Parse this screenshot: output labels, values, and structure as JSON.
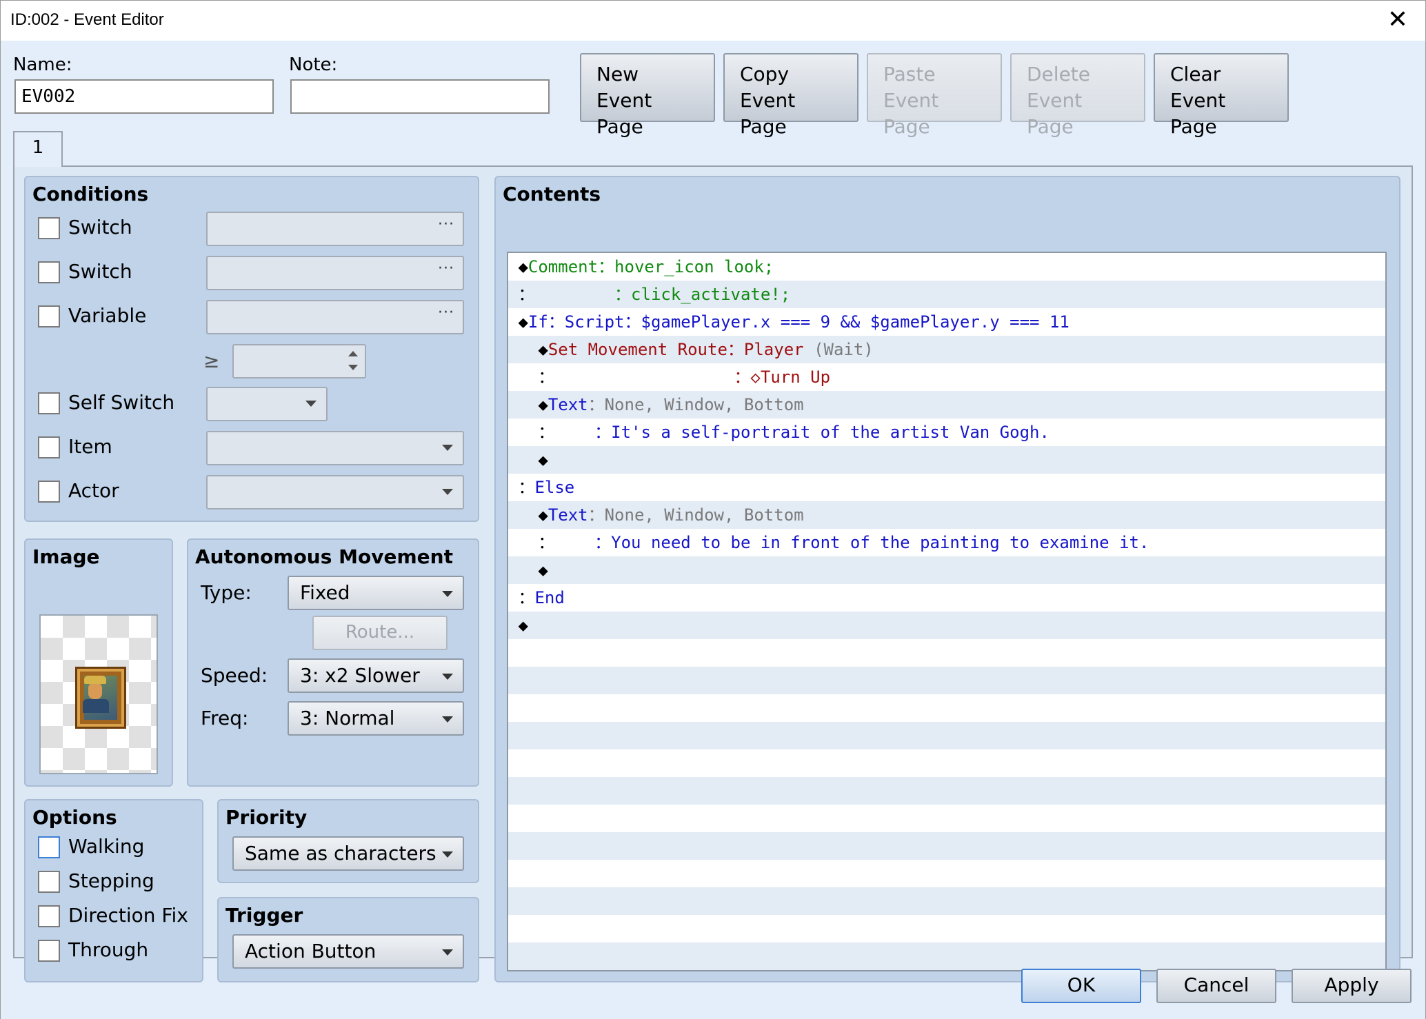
{
  "window": {
    "title": "ID:002 - Event Editor",
    "close_glyph": "✕"
  },
  "name": {
    "label": "Name:",
    "value": "EV002"
  },
  "note": {
    "label": "Note:",
    "value": ""
  },
  "page_buttons": [
    {
      "line1": "New",
      "line2": "Event Page",
      "enabled": true
    },
    {
      "line1": "Copy",
      "line2": "Event Page",
      "enabled": true
    },
    {
      "line1": "Paste",
      "line2": "Event Page",
      "enabled": false
    },
    {
      "line1": "Delete",
      "line2": "Event Page",
      "enabled": false
    },
    {
      "line1": "Clear",
      "line2": "Event Page",
      "enabled": true
    }
  ],
  "tabs": [
    {
      "label": "1"
    }
  ],
  "conditions": {
    "title": "Conditions",
    "switch1": "Switch",
    "switch2": "Switch",
    "variable": "Variable",
    "ge_symbol": "≥",
    "self_switch": "Self Switch",
    "item": "Item",
    "actor": "Actor",
    "dots": "···"
  },
  "image": {
    "title": "Image"
  },
  "autonomous": {
    "title": "Autonomous Movement",
    "type_label": "Type:",
    "type_value": "Fixed",
    "route_label": "Route...",
    "speed_label": "Speed:",
    "speed_value": "3: x2 Slower",
    "freq_label": "Freq:",
    "freq_value": "3: Normal"
  },
  "options": {
    "title": "Options",
    "walking": "Walking",
    "stepping": "Stepping",
    "direction_fix": "Direction Fix",
    "through": "Through"
  },
  "priority": {
    "title": "Priority",
    "value": "Same as characters"
  },
  "trigger": {
    "title": "Trigger",
    "value": "Action Button"
  },
  "contents": {
    "title": "Contents",
    "lines": [
      {
        "parts": [
          {
            "t": "◆",
            "c": "black"
          },
          {
            "t": "Comment",
            "c": "green"
          },
          {
            "t": "：hover_icon look;",
            "c": "green"
          }
        ]
      },
      {
        "parts": [
          {
            "t": "：        ",
            "c": "black"
          },
          {
            "t": "：click_activate!;",
            "c": "green"
          }
        ]
      },
      {
        "parts": [
          {
            "t": "◆",
            "c": "black"
          },
          {
            "t": "If",
            "c": "blue"
          },
          {
            "t": "：Script：$gamePlayer.x === 9 && $gamePlayer.y === 11",
            "c": "blue"
          }
        ]
      },
      {
        "parts": [
          {
            "t": "  ◆",
            "c": "black"
          },
          {
            "t": "Set Movement Route",
            "c": "red"
          },
          {
            "t": "：Player ",
            "c": "red"
          },
          {
            "t": "(Wait)",
            "c": "gray"
          }
        ]
      },
      {
        "parts": [
          {
            "t": "  ：                  ",
            "c": "black"
          },
          {
            "t": "：◇Turn Up",
            "c": "red"
          }
        ]
      },
      {
        "parts": [
          {
            "t": "  ◆",
            "c": "black"
          },
          {
            "t": "Text",
            "c": "blue"
          },
          {
            "t": "：None, Window, Bottom",
            "c": "gray"
          }
        ]
      },
      {
        "parts": [
          {
            "t": "  ：    ",
            "c": "black"
          },
          {
            "t": "：It's a self-portrait of the artist Van Gogh.",
            "c": "blue"
          }
        ]
      },
      {
        "parts": [
          {
            "t": "  ◆",
            "c": "black"
          }
        ]
      },
      {
        "parts": [
          {
            "t": "：",
            "c": "black"
          },
          {
            "t": "Else",
            "c": "blue"
          }
        ]
      },
      {
        "parts": [
          {
            "t": "  ◆",
            "c": "black"
          },
          {
            "t": "Text",
            "c": "blue"
          },
          {
            "t": "：None, Window, Bottom",
            "c": "gray"
          }
        ]
      },
      {
        "parts": [
          {
            "t": "  ：    ",
            "c": "black"
          },
          {
            "t": "：You need to be in front of the painting to examine it.",
            "c": "blue"
          }
        ]
      },
      {
        "parts": [
          {
            "t": "  ◆",
            "c": "black"
          }
        ]
      },
      {
        "parts": [
          {
            "t": "：",
            "c": "black"
          },
          {
            "t": "End",
            "c": "blue"
          }
        ]
      },
      {
        "parts": [
          {
            "t": "◆",
            "c": "black"
          }
        ]
      }
    ]
  },
  "footer": {
    "ok": "OK",
    "cancel": "Cancel",
    "apply": "Apply"
  }
}
